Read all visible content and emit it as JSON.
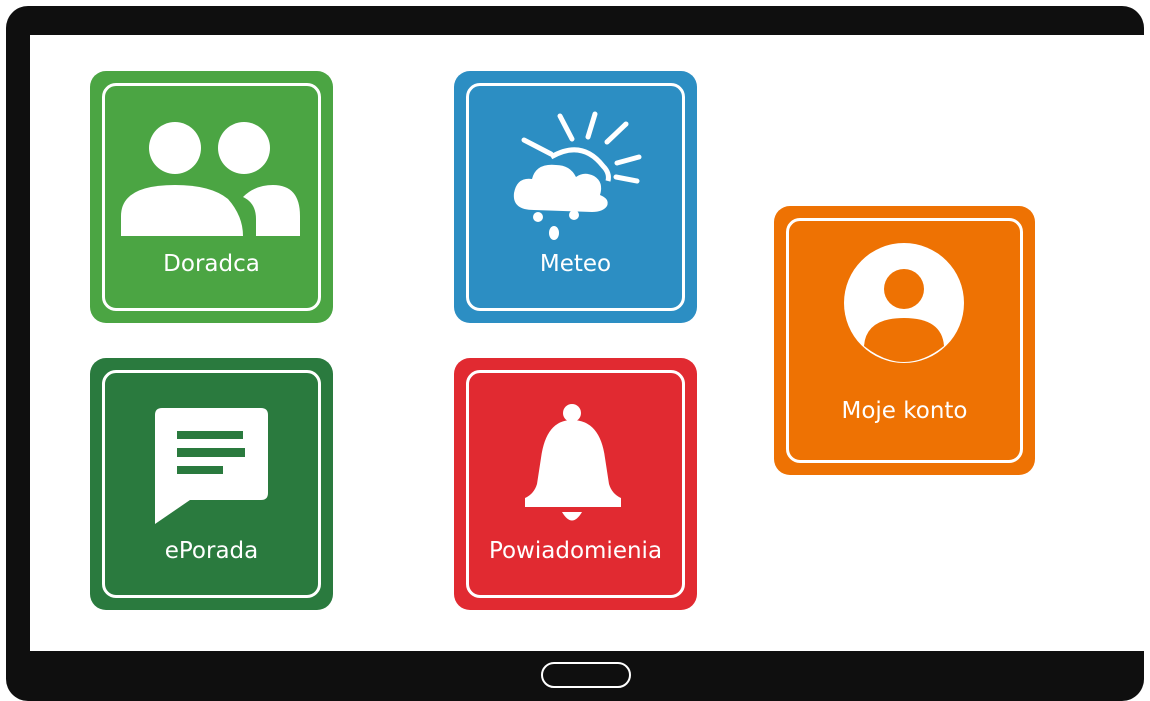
{
  "tiles": {
    "doradca": {
      "label": "Doradca",
      "color": "#4ba543",
      "icon": "people-icon"
    },
    "meteo": {
      "label": "Meteo",
      "color": "#2c8ec3",
      "icon": "weather-icon"
    },
    "eporada": {
      "label": "ePorada",
      "color": "#2a7a3e",
      "icon": "chat-message-icon"
    },
    "powiadomienia": {
      "label": "Powiadomienia",
      "color": "#e12a31",
      "icon": "bell-icon"
    },
    "moje_konto": {
      "label": "Moje konto",
      "color": "#ee7203",
      "icon": "account-icon"
    }
  },
  "device": {
    "frame_color": "#0f0f0f",
    "screen_color": "#ffffff"
  }
}
